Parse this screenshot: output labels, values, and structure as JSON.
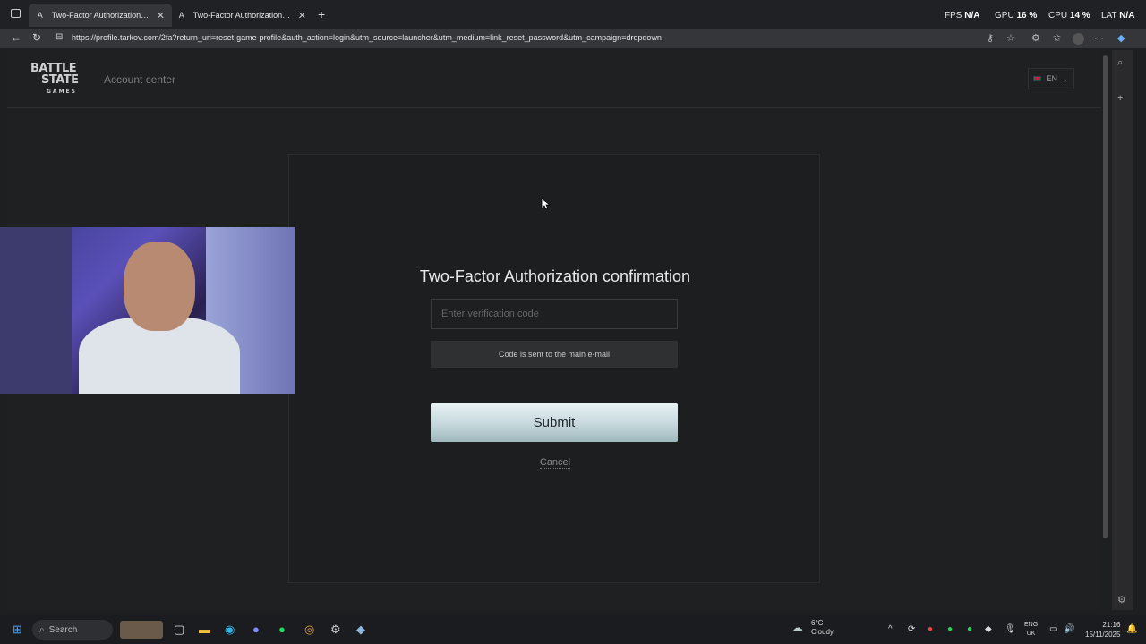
{
  "browser": {
    "tabs": [
      {
        "title": "Two-Factor Authorization confirm",
        "active": true
      },
      {
        "title": "Two-Factor Authorization confirm",
        "active": false
      }
    ],
    "url": "https://profile.tarkov.com/2fa?return_uri=reset-game-profile&auth_action=login&utm_source=launcher&utm_medium=link_reset_password&utm_campaign=dropdown"
  },
  "overlay": {
    "fps_label": "FPS",
    "fps_value": "N/A",
    "gpu_label": "GPU",
    "gpu_value": "16 %",
    "cpu_label": "CPU",
    "cpu_value": "14 %",
    "lat_label": "LAT",
    "lat_value": "N/A"
  },
  "header": {
    "logo_top": "BATTLE",
    "logo_mid": "STATE",
    "logo_bottom": "GAMES",
    "section": "Account center",
    "language": "EN"
  },
  "form": {
    "title": "Two-Factor Authorization confirmation",
    "code_placeholder": "Enter verification code",
    "info": "Code is sent to the main e-mail",
    "submit_label": "Submit",
    "cancel_label": "Cancel"
  },
  "taskbar": {
    "search_label": "Search",
    "temperature": "6°C",
    "condition": "Cloudy",
    "lang_top": "ENG",
    "lang_bottom": "UK",
    "time": "21:16",
    "date": "15/11/2025"
  },
  "colors": {
    "page_bg": "#1e2021",
    "submit_gradient_top": "#e8f1f3",
    "submit_gradient_bottom": "#9fb8bd"
  }
}
